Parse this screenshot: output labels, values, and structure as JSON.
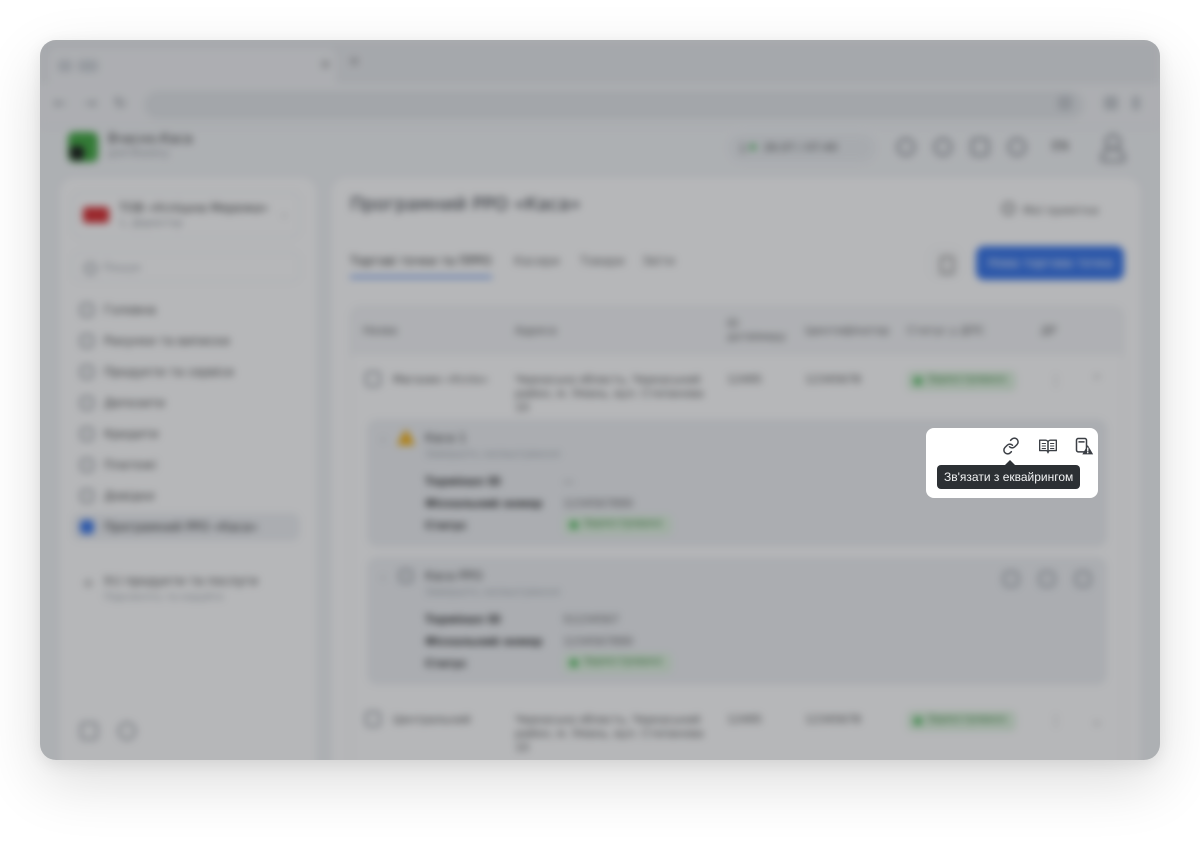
{
  "app": {
    "brand_name": "Вчасно.Каса",
    "brand_sub": "для бізнесу",
    "date_time": "26.07 / 07:40",
    "lang": "EN"
  },
  "sidebar": {
    "company_name": "ТОВ «Успішна Мережа»",
    "company_sub": "1, Директор",
    "search_placeholder": "Пошук",
    "items": [
      {
        "label": "Головна"
      },
      {
        "label": "Рахунки та виписки"
      },
      {
        "label": "Продукти та сервіси"
      },
      {
        "label": "Депозити"
      },
      {
        "label": "Кредити"
      },
      {
        "label": "Платежі"
      },
      {
        "label": "Довідки"
      },
      {
        "label": "Програмний РРО «Каса»"
      }
    ],
    "extra_title": "Усі продукти та послуги",
    "extra_sub": "Підключіть та керуйте"
  },
  "main": {
    "title": "Програмний РРО «Каса»",
    "help": "Мої примітки",
    "tabs": [
      "Торгові точки та ПРРО",
      "Касири",
      "Товари",
      "Звіти"
    ],
    "primary_button": "Нова торгова точка",
    "table": {
      "headers": [
        "Назва",
        "Адреса",
        "ID дотвімеру",
        "Ідентифікатор",
        "Статус у ДПС",
        "ДР"
      ],
      "rows": [
        {
          "name": "Магазин «Успіх»",
          "address": "Черкаська область, Черкаський район, м. Умань, вул. Степанова 10",
          "id": "12495",
          "code": "12345678",
          "status": "Зареєстровано"
        },
        {
          "name": "Центральний",
          "address": "Черкаська область, Черкаський район, м. Умань, вул. Степанова 10",
          "id": "12495",
          "code": "12345678",
          "status": "Зареєстровано"
        }
      ],
      "cards": [
        {
          "title": "Каса 1",
          "sub": "Завершіть налаштування",
          "k1": "Термінал ID",
          "v1": "—",
          "k2": "Фіскальний номер",
          "v2": "1234567890",
          "k3": "Статус",
          "v3": "Зареєстровано"
        },
        {
          "title": "Каса РРО",
          "sub": "Завершіть налаштування",
          "k1": "Термінал ID",
          "v1": "S1234567",
          "k2": "Фіскальний номер",
          "v2": "1234567890",
          "k3": "Статус",
          "v3": "Зареєстровано"
        }
      ]
    }
  },
  "spotlight": {
    "tooltip": "Зв'язати з еквайрингом",
    "icons": [
      "link-icon",
      "open-book-icon",
      "register-warning-icon"
    ]
  }
}
